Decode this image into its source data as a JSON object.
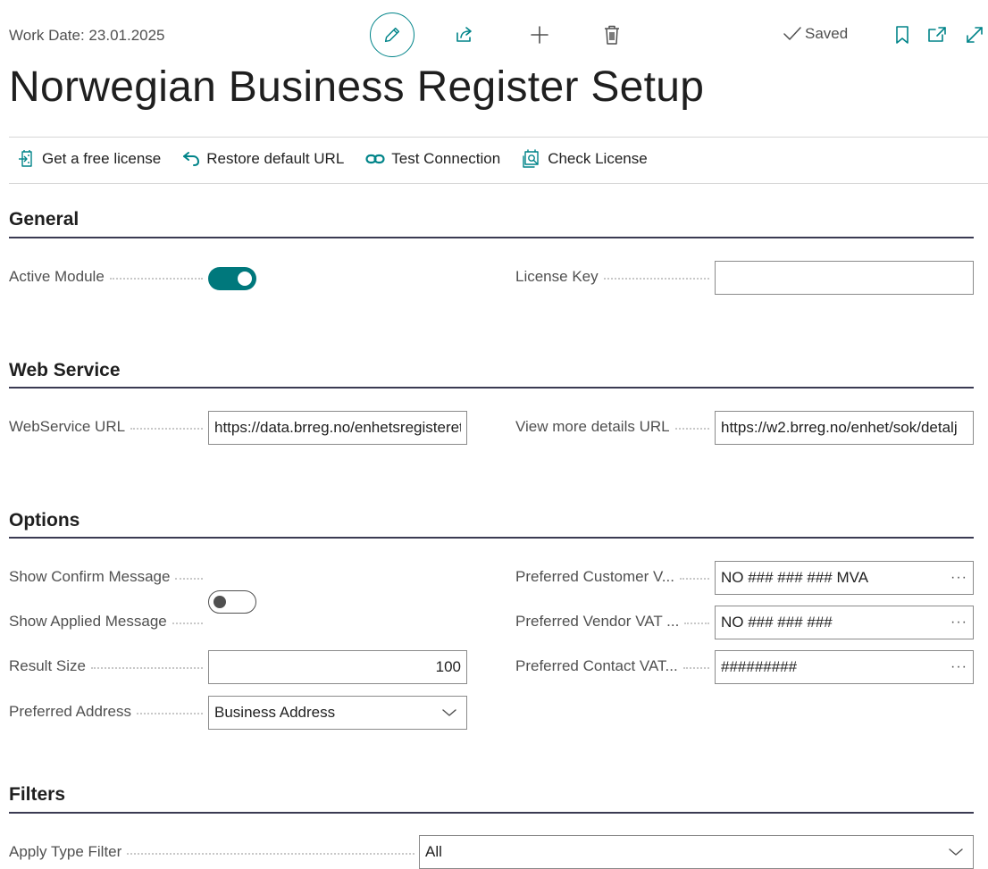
{
  "header": {
    "work_date": "Work Date: 23.01.2025",
    "saved": "Saved"
  },
  "page": {
    "title": "Norwegian Business Register Setup"
  },
  "actions": [
    {
      "label": "Get a free license",
      "icon": "license-icon"
    },
    {
      "label": "Restore default URL",
      "icon": "undo-icon"
    },
    {
      "label": "Test Connection",
      "icon": "link-icon"
    },
    {
      "label": "Check License",
      "icon": "check-license-icon"
    }
  ],
  "general": {
    "title": "General",
    "active_module_label": "Active Module",
    "active_module": true,
    "license_key_label": "License Key",
    "license_key": ""
  },
  "web_service": {
    "title": "Web Service",
    "url_label": "WebService URL",
    "url": "https://data.brreg.no/enhetsregisteret",
    "details_label": "View more details URL",
    "details_url": "https://w2.brreg.no/enhet/sok/detalj"
  },
  "options": {
    "title": "Options",
    "show_confirm_label": "Show Confirm Message",
    "show_confirm": false,
    "show_applied_label": "Show Applied Message",
    "show_applied": true,
    "result_size_label": "Result Size",
    "result_size": "100",
    "preferred_address_label": "Preferred Address",
    "preferred_address": "Business Address",
    "pref_customer_label": "Preferred Customer V...",
    "pref_customer": "NO ### ### ### MVA",
    "pref_vendor_label": "Preferred Vendor VAT ...",
    "pref_vendor": "NO ### ### ###",
    "pref_contact_label": "Preferred Contact VAT...",
    "pref_contact": "#########",
    "ellipsis": "···"
  },
  "filters": {
    "title": "Filters",
    "apply_type_label": "Apply Type Filter",
    "apply_type": "All"
  },
  "colors": {
    "accent": "#00787c",
    "rule": "#3a3a52"
  }
}
